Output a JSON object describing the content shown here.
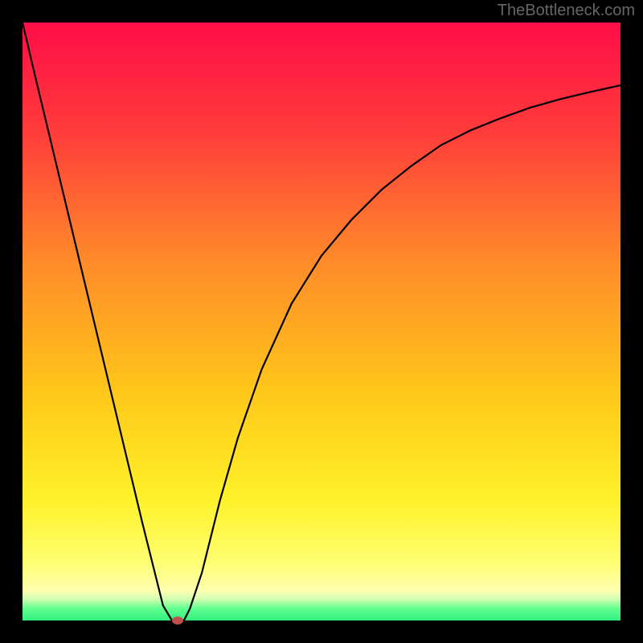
{
  "watermark": "TheBottleneck.com",
  "chart_data": {
    "type": "line",
    "title": "",
    "xlabel": "",
    "ylabel": "",
    "xlim": [
      0,
      100
    ],
    "ylim": [
      0,
      100
    ],
    "gradient": {
      "stops": [
        {
          "offset": 0,
          "color": "#ff0d47"
        },
        {
          "offset": 0.18,
          "color": "#ff3b3b"
        },
        {
          "offset": 0.4,
          "color": "#ff8b2a"
        },
        {
          "offset": 0.62,
          "color": "#ffc81a"
        },
        {
          "offset": 0.8,
          "color": "#fff22a"
        },
        {
          "offset": 0.9,
          "color": "#ffff70"
        },
        {
          "offset": 0.95,
          "color": "#ffffb0"
        },
        {
          "offset": 0.965,
          "color": "#d0ffb0"
        },
        {
          "offset": 0.98,
          "color": "#60ff90"
        },
        {
          "offset": 1.0,
          "color": "#30ef80"
        }
      ]
    },
    "curve": {
      "x": [
        0,
        2,
        5,
        8,
        11,
        14,
        17,
        20,
        22,
        23.5,
        25,
        26,
        27,
        28,
        30,
        33,
        36,
        40,
        45,
        50,
        55,
        60,
        65,
        70,
        75,
        80,
        85,
        90,
        95,
        100
      ],
      "y": [
        100,
        91.5,
        79,
        66.5,
        54,
        41.5,
        29,
        16.5,
        8.5,
        2.5,
        0,
        0,
        0,
        2,
        8,
        20,
        30.5,
        42,
        53,
        61,
        67,
        72,
        76,
        79.5,
        82,
        84,
        85.8,
        87.2,
        88.4,
        89.5
      ]
    },
    "marker": {
      "x": 26,
      "y": 0
    }
  }
}
